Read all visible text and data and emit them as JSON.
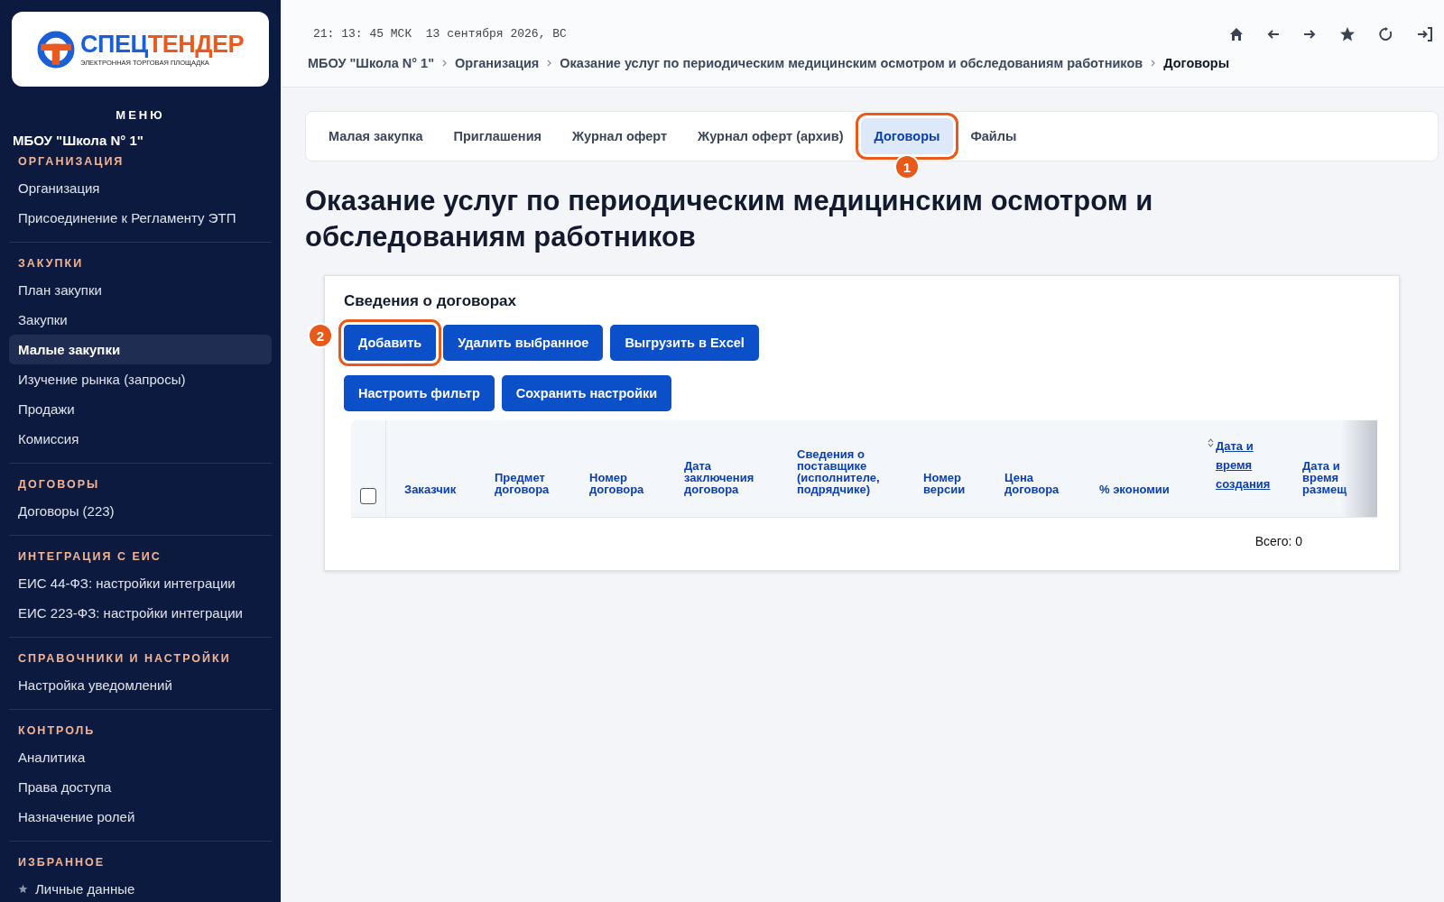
{
  "logo": {
    "part1": "СПЕЦ",
    "part2": "ТЕНДЕР",
    "tagline": "ЭЛЕКТРОННАЯ ТОРГОВАЯ ПЛОЩАДКА"
  },
  "sidebar": {
    "menu_title": "МЕНЮ",
    "organization": "МБОУ \"Школа N° 1\"",
    "groups": [
      {
        "title": "ОРГАНИЗАЦИЯ",
        "items": [
          {
            "label": "Организация",
            "selected": false
          },
          {
            "label": "Присоединение к Регламенту ЭТП",
            "selected": false
          }
        ]
      },
      {
        "title": "ЗАКУПКИ",
        "items": [
          {
            "label": "План закупки",
            "selected": false
          },
          {
            "label": "Закупки",
            "selected": false
          },
          {
            "label": "Малые закупки",
            "selected": true
          },
          {
            "label": "Изучение рынка (запросы)",
            "selected": false
          },
          {
            "label": "Продажи",
            "selected": false
          },
          {
            "label": "Комиссия",
            "selected": false
          }
        ]
      },
      {
        "title": "ДОГОВОРЫ",
        "items": [
          {
            "label": "Договоры (223)",
            "selected": false
          }
        ]
      },
      {
        "title": "ИНТЕГРАЦИЯ С ЕИС",
        "items": [
          {
            "label": "ЕИС 44-ФЗ: настройки интеграции",
            "selected": false
          },
          {
            "label": "ЕИС 223-ФЗ: настройки интеграции",
            "selected": false
          }
        ]
      },
      {
        "title": "СПРАВОЧНИКИ И НАСТРОЙКИ",
        "items": [
          {
            "label": "Настройка уведомлений",
            "selected": false
          }
        ]
      },
      {
        "title": "КОНТРОЛЬ",
        "items": [
          {
            "label": "Аналитика",
            "selected": false
          },
          {
            "label": "Права доступа",
            "selected": false
          },
          {
            "label": "Назначение ролей",
            "selected": false
          }
        ]
      },
      {
        "title": "ИЗБРАННОЕ",
        "items": [
          {
            "label": "Личные данные",
            "selected": false,
            "starred": true
          }
        ]
      }
    ]
  },
  "header": {
    "clock": "21: 13: 45 МСК  13 сентября 2026, ВС",
    "breadcrumbs": [
      "МБОУ \"Школа N° 1\"",
      "Организация",
      "Оказание услуг по периодическим медицинским осмотром и обследованиям работников",
      "Договоры"
    ]
  },
  "tabs": [
    {
      "label": "Малая закупка",
      "selected": false
    },
    {
      "label": "Приглашения",
      "selected": false
    },
    {
      "label": "Журнал оферт",
      "selected": false
    },
    {
      "label": "Журнал оферт (архив)",
      "selected": false
    },
    {
      "label": "Договоры",
      "selected": true,
      "callout": "1"
    },
    {
      "label": "Файлы",
      "selected": false
    }
  ],
  "page_title": "Оказание услуг по периодическим медицинским осмотром и обследованиям работников",
  "card": {
    "title": "Сведения о договорах",
    "buttons": [
      {
        "label": "Добавить",
        "callout": "2"
      },
      {
        "label": "Удалить выбранное"
      },
      {
        "label": "Выгрузить в Excel"
      },
      {
        "label": "Настроить фильтр"
      },
      {
        "label": "Сохранить настройки"
      }
    ],
    "table": {
      "select_all_checked": false,
      "columns": [
        {
          "label": "Заказчик",
          "sortable": false
        },
        {
          "label": "Предмет договора",
          "sortable": false
        },
        {
          "label": "Номер договора",
          "sortable": false
        },
        {
          "label": "Дата заключения договора",
          "sortable": false
        },
        {
          "label": "Сведения о поставщике (исполнителе, подрядчике)",
          "sortable": false
        },
        {
          "label": "Номер версии",
          "sortable": false
        },
        {
          "label": "Цена договора",
          "sortable": false
        },
        {
          "label": "% экономии",
          "sortable": false
        },
        {
          "label": "Дата и время создания",
          "sortable": true
        },
        {
          "label": "Дата и время размещ",
          "sortable": false
        }
      ]
    },
    "total": "Всего: 0"
  }
}
